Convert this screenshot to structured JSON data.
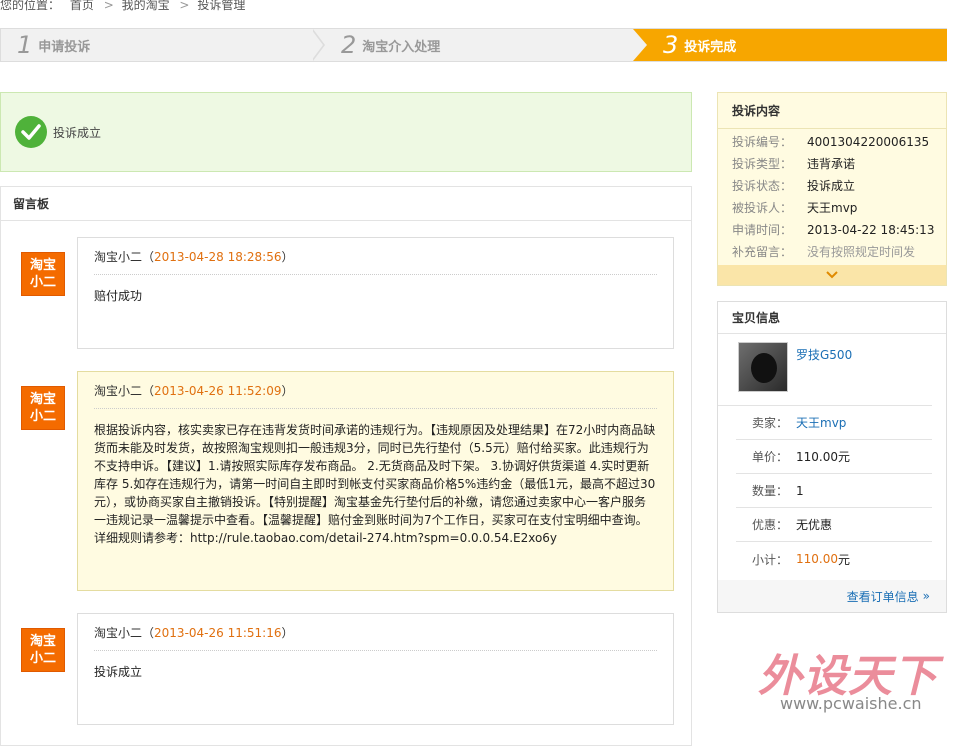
{
  "breadcrumb": {
    "prefix": "您的位置：",
    "items": [
      "首页",
      "我的淘宝",
      "投诉管理"
    ],
    "separator": ">"
  },
  "steps": [
    {
      "num": "1",
      "label": "申请投诉"
    },
    {
      "num": "2",
      "label": "淘宝介入处理"
    },
    {
      "num": "3",
      "label": "投诉完成"
    }
  ],
  "success": {
    "text": "投诉成立"
  },
  "board": {
    "title": "留言板",
    "messages": [
      {
        "avatar": [
          "淘宝",
          "小二"
        ],
        "author": "淘宝小二",
        "time": "2013-04-28 18:28:56",
        "body": "赔付成功"
      },
      {
        "avatar": [
          "淘宝",
          "小二"
        ],
        "author": "淘宝小二",
        "time": "2013-04-26 11:52:09",
        "body": "根据投诉内容，核实卖家已存在违背发货时间承诺的违规行为。【违规原因及处理结果】在72小时内商品缺货而未能及时发货，故按照淘宝规则扣一般违规3分，同时已先行垫付（5.5元）赔付给买家。此违规行为不支持申诉。【建议】1.请按照实际库存发布商品。 2.无货商品及时下架。 3.协调好供货渠道 4.实时更新库存 5.如存在违规行为，请第一时间自主即时到帐支付买家商品价格5%违约金（最低1元，最高不超过30元），或协商买家自主撤销投诉。【特别提醒】淘宝基金先行垫付后的补缴，请您通过卖家中心一客户服务一违规记录一温馨提示中查看。【温馨提醒】赔付金到账时间为7个工作日，买家可在支付宝明细中查询。详细规则请参考：http://rule.taobao.com/detail-274.htm?spm=0.0.0.54.E2xo6y"
      },
      {
        "avatar": [
          "淘宝",
          "小二"
        ],
        "author": "淘宝小二",
        "time": "2013-04-26 11:51:16",
        "body": "投诉成立"
      }
    ]
  },
  "complaint": {
    "title": "投诉内容",
    "rows": [
      {
        "k": "投诉编号：",
        "v": "4001304220006135"
      },
      {
        "k": "投诉类型：",
        "v": "违背承诺"
      },
      {
        "k": "投诉状态：",
        "v": "投诉成立"
      },
      {
        "k": "被投诉人：",
        "v": "天王mvp"
      },
      {
        "k": "申请时间：",
        "v": "2013-04-22 18:45:13"
      },
      {
        "k": "补充留言：",
        "v": "没有按照规定时间发"
      }
    ],
    "expand_icon": "chevron-down-icon"
  },
  "item": {
    "title": "宝贝信息",
    "name": "罗技G500",
    "seller_label": "卖家：",
    "seller": "天王mvp",
    "price_label": "单价：",
    "price": "110.00元",
    "qty_label": "数量：",
    "qty": "1",
    "discount_label": "优惠：",
    "discount": "无优惠",
    "subtotal_label": "小计：",
    "subtotal_num": "110.00",
    "subtotal_unit": "元",
    "view_order": "查看订单信息"
  },
  "watermark": {
    "text": "外设天下",
    "url": "www.pcwaishe.cn"
  },
  "colors": {
    "accent": "#f7a600",
    "avatar": "#f46b00",
    "success_bg": "#eef9e3",
    "link": "#1b6fb5"
  }
}
